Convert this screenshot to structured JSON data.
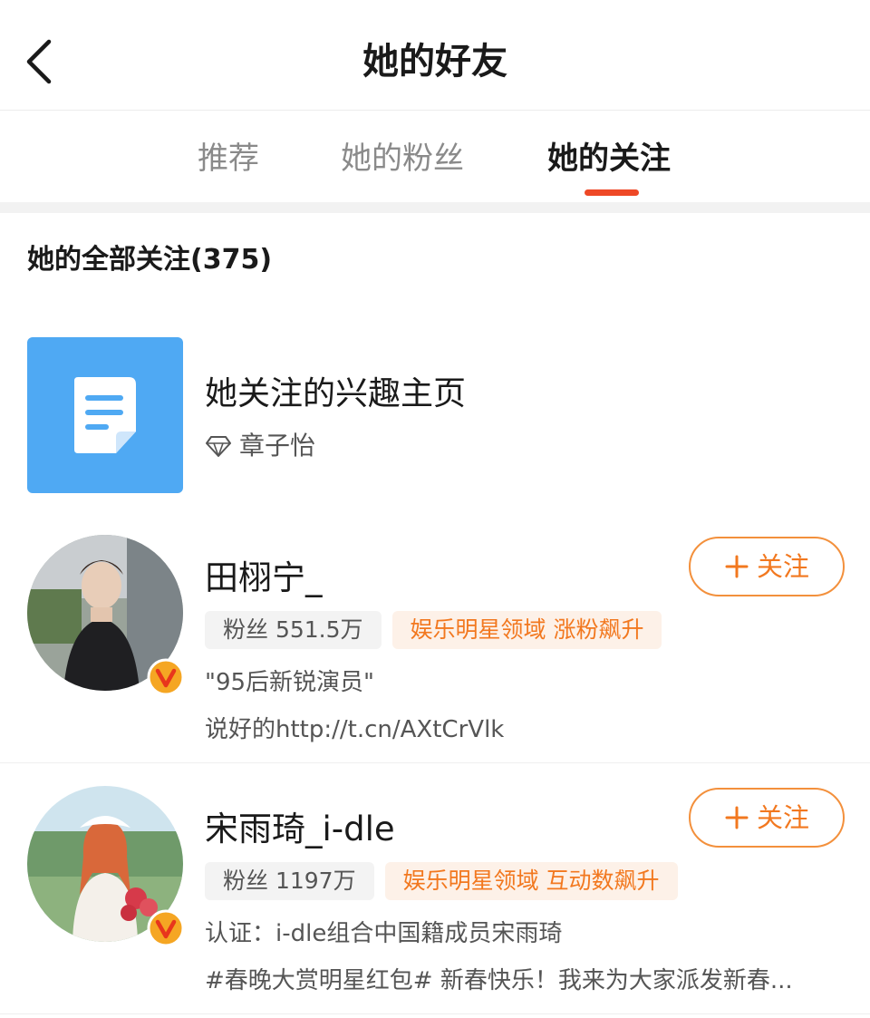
{
  "nav": {
    "title": "她的好友"
  },
  "tabs": [
    {
      "label": "推荐"
    },
    {
      "label": "她的粉丝"
    },
    {
      "label": "她的关注"
    }
  ],
  "active_tab": 2,
  "section": {
    "title": "她的全部关注(375)"
  },
  "interest": {
    "title": "她关注的兴趣主页",
    "owner": "章子怡"
  },
  "users": [
    {
      "name": "田栩宁_",
      "fans": "粉丝 551.5万",
      "badge": "娱乐明星领域 涨粉飙升",
      "desc": "\"95后新锐演员\"",
      "desc2": "说好的http://t.cn/AXtCrVlk",
      "follow_label": "关注"
    },
    {
      "name": "宋雨琦_i-dle",
      "fans": "粉丝 1197万",
      "badge": "娱乐明星领域 互动数飙升",
      "desc": "认证：i-dle组合中国籍成员宋雨琦",
      "desc2": "#春晚大赏明星红包# 新春快乐！我来为大家派发新春...",
      "follow_label": "关注"
    }
  ],
  "colors": {
    "accent": "#ee4826",
    "follow_orange": "#f2781f",
    "tile_blue": "#4fa9f3",
    "verified_badge": "#f5a623"
  },
  "icons": {
    "back": "chevron-left-icon",
    "interest": "document-icon",
    "owner": "diamond-icon",
    "verified": "verified-v-badge-icon",
    "follow": "plus-icon"
  }
}
